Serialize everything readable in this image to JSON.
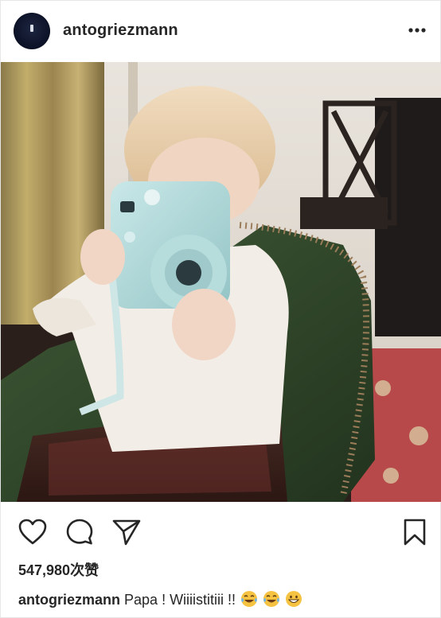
{
  "post": {
    "username": "antogriezmann",
    "likes_text": "547,980次赞",
    "caption_user": "antogriezmann",
    "caption_text": "Papa ! Wiiiistitiii !!",
    "caption_emojis": [
      "laughing-tears-emoji",
      "laughing-tears-emoji",
      "grinning-emoji"
    ]
  },
  "icons": {
    "more": "more-options-icon",
    "like": "heart-icon",
    "comment": "comment-icon",
    "share": "paper-plane-icon",
    "save": "bookmark-icon"
  },
  "colors": {
    "text": "#262626",
    "avatar_bg": "#0b1126",
    "emoji": "#f5c242"
  }
}
